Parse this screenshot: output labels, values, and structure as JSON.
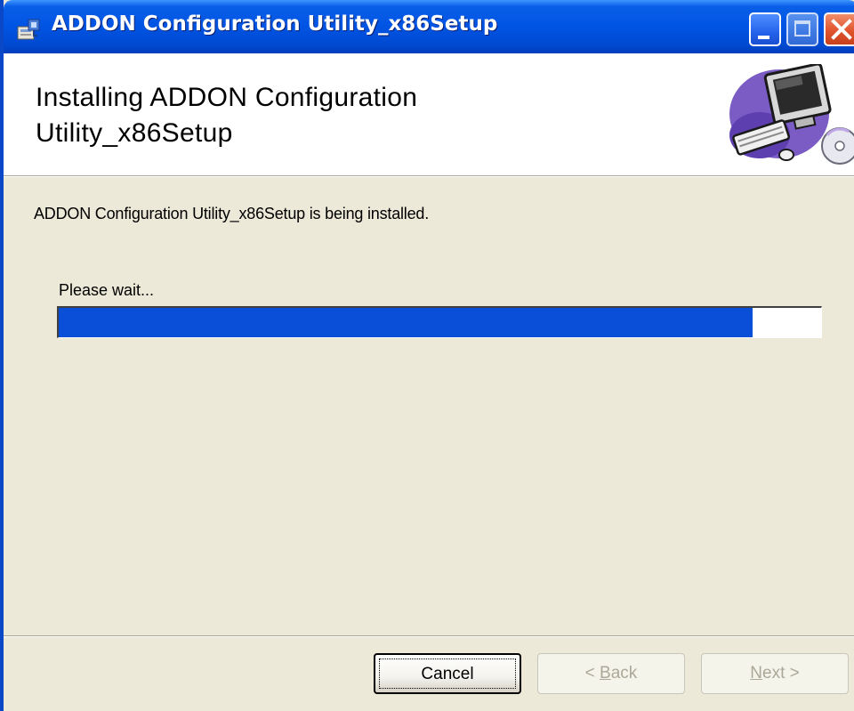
{
  "window": {
    "title": "ADDON Configuration Utility_x86Setup"
  },
  "header": {
    "title": "Installing ADDON Configuration Utility_x86Setup"
  },
  "body": {
    "status_text": "ADDON Configuration Utility_x86Setup is being installed.",
    "progress_label": "Please wait...",
    "progress_fraction": 0.91
  },
  "buttons": {
    "cancel": {
      "label": "Cancel"
    },
    "back": {
      "prefix": "< ",
      "accel": "B",
      "rest": "ack"
    },
    "next": {
      "accel": "N",
      "rest": "ext",
      "suffix": " >"
    }
  },
  "colors": {
    "titlebar": "#0054E3",
    "dialog_bg": "#ECE9D8",
    "progress_fill": "#0A4FD8"
  },
  "icons": [
    "installer-icon",
    "computer-graphic",
    "minimize-icon",
    "maximize-icon",
    "close-icon"
  ]
}
